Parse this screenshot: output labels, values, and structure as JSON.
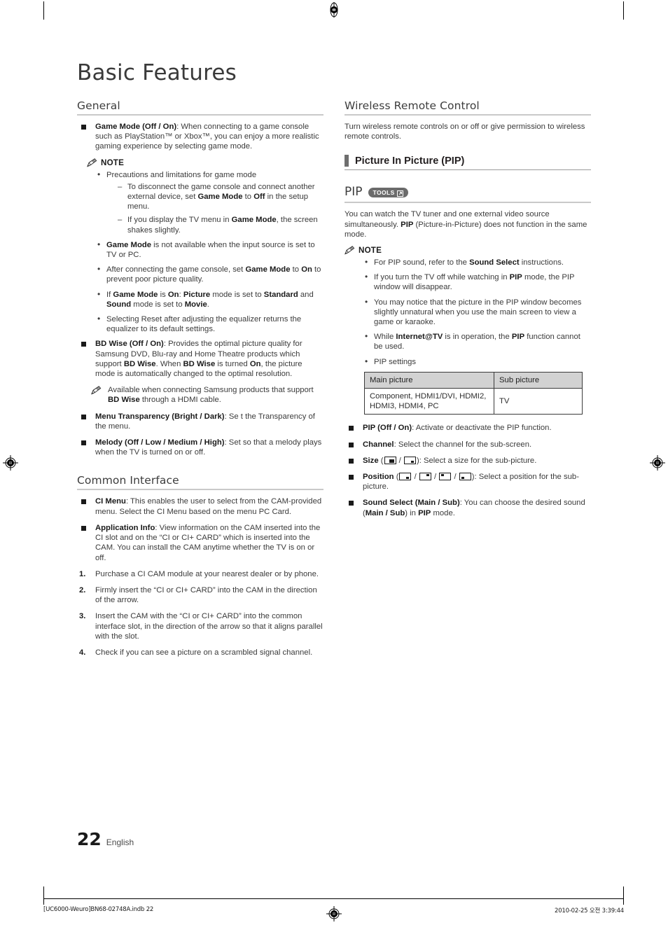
{
  "document": {
    "title": "Basic Features",
    "page_number": "22",
    "language": "English"
  },
  "left_column": {
    "general": {
      "heading": "General",
      "items": [
        {
          "label": "Game Mode (Off / On)",
          "text": ": When connecting to a game console such as PlayStation™ or Xbox™, you can enjoy a more realistic gaming experience by selecting game mode."
        }
      ],
      "note_label": "NOTE",
      "notes": [
        {
          "text": "Precautions and limitations for game mode",
          "sub": [
            "To disconnect the game console and connect another external device, set <b>Game Mode</b> to <b>Off</b> in the setup menu.",
            "If you display the TV menu in <b>Game Mode</b>, the screen shakes slightly."
          ]
        },
        {
          "html": "<b>Game Mode</b> is not available when the input source is set to TV or PC."
        },
        {
          "html": "After connecting the game console, set <b>Game Mode</b> to <b>On</b> to prevent poor picture quality."
        },
        {
          "html": "If <b>Game Mode</b> is <b>On</b>: <b>Picture</b> mode is set to <b>Standard</b> and <b>Sound</b> mode is set to <b>Movie</b>."
        },
        {
          "html": "Selecting Reset after adjusting the equalizer returns the equalizer to its default settings."
        }
      ],
      "bd_wise": {
        "label": "BD Wise (Off / On)",
        "text": ": Provides the optimal picture quality for Samsung DVD, Blu-ray and Home Theatre products which support <b>BD Wise</b>. When <b>BD Wise</b> is turned <b>On</b>, the picture mode is automatically changed to the optimal resolution.",
        "subnote": "Available when connecting Samsung products that support <b>BD Wise</b> through a HDMI cable."
      },
      "menu_transparency": {
        "label": "Menu Transparency (Bright / Dark)",
        "text": ": Se t the Transparency of the menu."
      },
      "melody": {
        "label": "Melody (Off / Low / Medium / High)",
        "text": ": Set so that a melody plays when the TV is turned on or off."
      }
    },
    "common_interface": {
      "heading": "Common Interface",
      "items": [
        {
          "label": "CI Menu",
          "text": ": This enables the user to select from the CAM-provided menu. Select the CI Menu based on the menu PC Card."
        },
        {
          "label": "Application Info",
          "text": ": View information on the CAM inserted into the CI slot and on the “CI or CI+ CARD” which is inserted into the CAM. You can install the CAM anytime whether the TV is on or off."
        }
      ],
      "steps": [
        {
          "num": "1.",
          "text": "Purchase a CI CAM module at your nearest dealer or by phone."
        },
        {
          "num": "2.",
          "text": "Firmly insert the “CI or CI+ CARD” into the CAM in the direction of the arrow."
        },
        {
          "num": "3.",
          "text": "Insert the CAM with the “CI or CI+ CARD” into the common interface slot, in the direction of the arrow so that it aligns parallel with the slot."
        },
        {
          "num": "4.",
          "text": "Check if you can see a picture on a scrambled signal channel."
        }
      ]
    }
  },
  "right_column": {
    "wireless": {
      "heading": "Wireless Remote Control",
      "body": "Turn wireless remote controls on or off or give permission to wireless remote controls."
    },
    "pip_section": {
      "subheading": "Picture In Picture (PIP)",
      "title": "PIP",
      "tools_badge": "TOOLS",
      "intro": "You can watch the TV tuner and one external video source simultaneously. <b>PIP</b> (Picture-in-Picture) does not function in the same mode.",
      "note_label": "NOTE",
      "notes": [
        {
          "html": "For PIP sound, refer to the <b>Sound Select</b> instructions."
        },
        {
          "html": "If you turn the TV off while watching in <b>PIP</b> mode, the PIP window will disappear."
        },
        {
          "html": "You may notice that the picture in the PIP window becomes slightly unnatural when you use the main screen to view a game or karaoke."
        },
        {
          "html": "While <b>Internet@TV</b> is in operation, the <b>PIP</b> function cannot be used."
        },
        {
          "html": "PIP settings"
        }
      ],
      "table": {
        "headers": [
          "Main picture",
          "Sub picture"
        ],
        "rows": [
          [
            "Component, HDMI1/DVI, HDMI2, HDMI3, HDMI4, PC",
            "TV"
          ]
        ]
      },
      "options": [
        {
          "label": "PIP (Off / On)",
          "text": ": Activate or deactivate the PIP function."
        },
        {
          "label": "Channel",
          "text": ": Select the channel for the sub-screen."
        },
        {
          "label": "Size",
          "glyphs": [
            "size-big",
            "size-small"
          ],
          "text": ": Select a size for the sub-picture."
        },
        {
          "label": "Position",
          "glyphs": [
            "pos-bottom-right",
            "pos-top-right",
            "pos-top-left",
            "pos-bottom-left"
          ],
          "text": ": Select a position for the sub-picture."
        },
        {
          "label": "Sound Select (Main / Sub)",
          "text": ": You can choose the desired sound (<b>Main / Sub</b>) in <b>PIP</b> mode."
        }
      ]
    }
  },
  "footer": {
    "left": "[UC6000-Weuro]BN68-02748A.indb   22",
    "right": "2010-02-25   오전 3:39:44"
  }
}
